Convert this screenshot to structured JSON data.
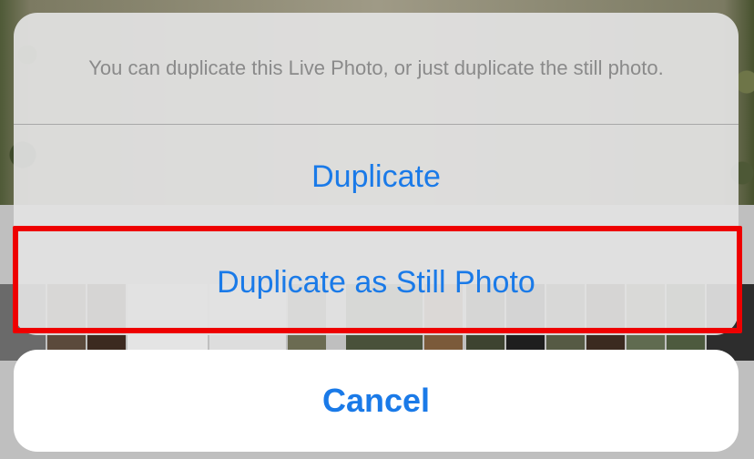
{
  "action_sheet": {
    "message": "You can duplicate this Live Photo, or just duplicate the still photo.",
    "actions": [
      {
        "label": "Duplicate"
      },
      {
        "label": "Duplicate as Still Photo",
        "highlighted": true
      }
    ],
    "cancel_label": "Cancel"
  },
  "colors": {
    "action_text": "#1a7ae8",
    "message_text": "#8a8a8a",
    "highlight_border": "#ee0000"
  }
}
